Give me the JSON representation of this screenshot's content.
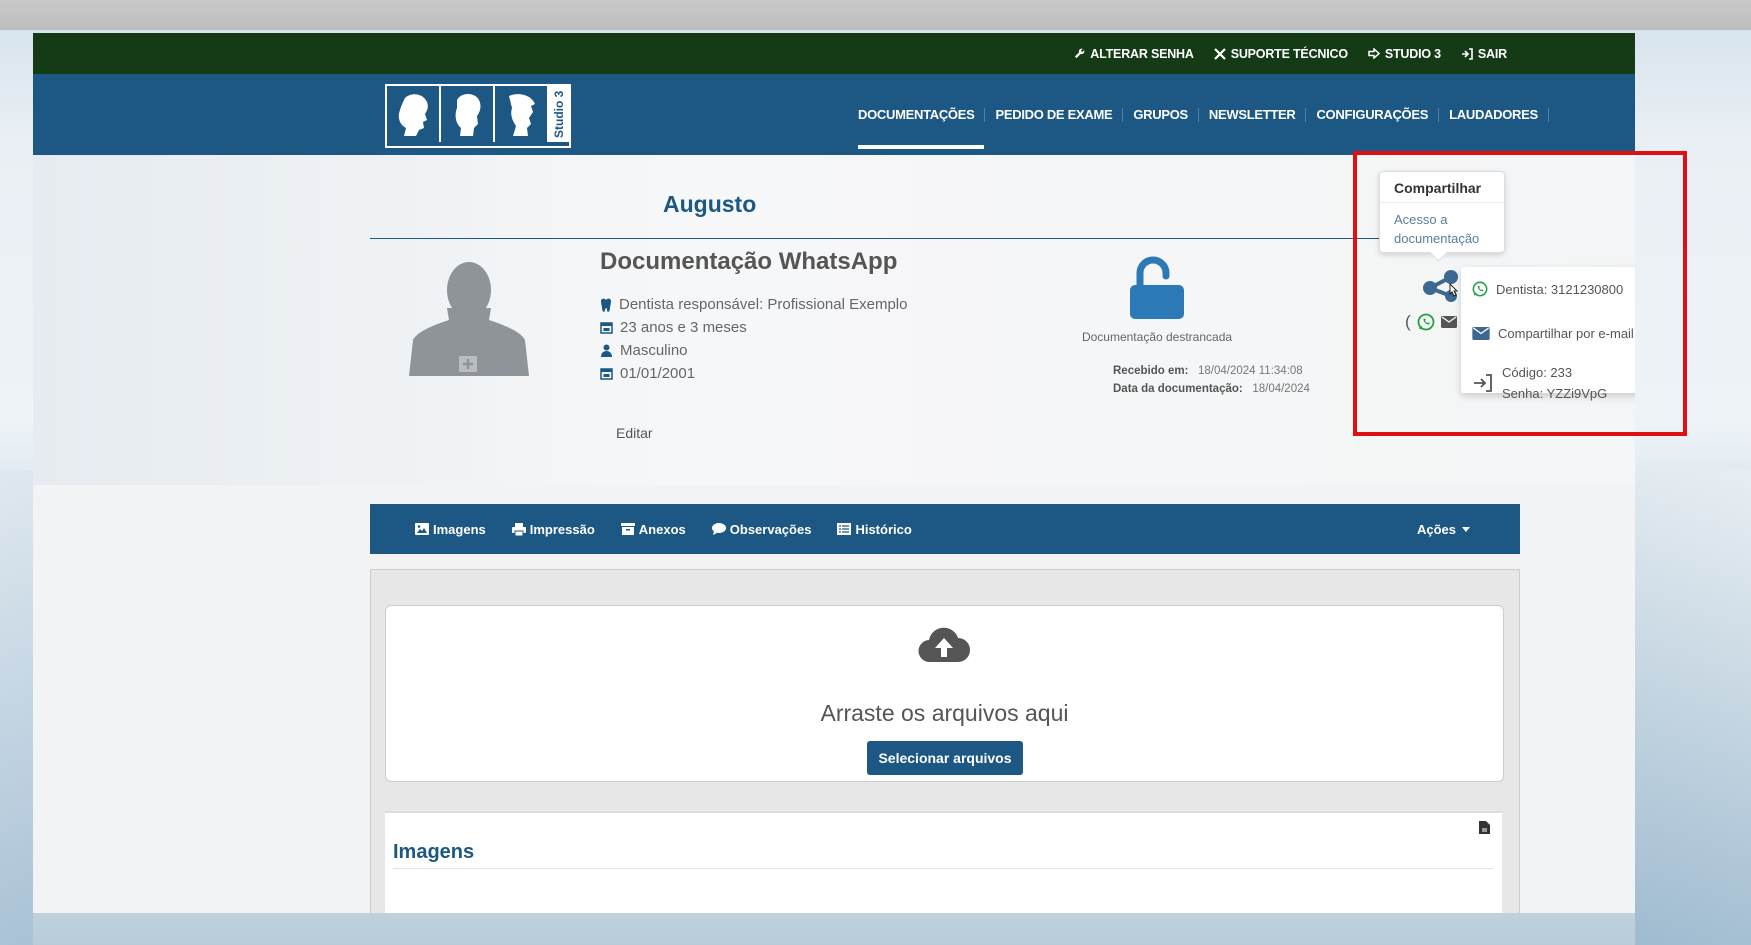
{
  "topbar": {
    "links": [
      {
        "label": "ALTERAR SENHA",
        "icon": "wrench-icon"
      },
      {
        "label": "SUPORTE TÉCNICO",
        "icon": "tools-icon"
      },
      {
        "label": "STUDIO 3",
        "icon": "arrow-right-icon"
      },
      {
        "label": "SAIR",
        "icon": "sign-out-icon"
      }
    ]
  },
  "logo": {
    "text": "Studio 3"
  },
  "nav": {
    "items": [
      "DOCUMENTAÇÕES",
      "PEDIDO DE EXAME",
      "GRUPOS",
      "NEWSLETTER",
      "CONFIGURAÇÕES",
      "LAUDADORES"
    ],
    "active": "DOCUMENTAÇÕES"
  },
  "patient": {
    "name": "Augusto",
    "doc_title": "Documentação WhatsApp",
    "dentist": "Dentista responsável: Profissional Exemplo",
    "age": "23 anos e 3 meses",
    "gender": "Masculino",
    "birthdate": "01/01/2001",
    "edit_label": "Editar"
  },
  "lock": {
    "label": "Documentação destrancada"
  },
  "meta": {
    "received_label": "Recebido em:",
    "received_value": "18/04/2024 11:34:08",
    "doc_date_label": "Data da documentação:",
    "doc_date_value": "18/04/2024"
  },
  "tooltip": {
    "title": "Compartilhar",
    "body": "Acesso a documentação"
  },
  "share_menu": {
    "whatsapp": "Dentista: 3121230800",
    "email": "Compartilhar por e-mail",
    "code": "Código: 233",
    "password": "Senha: YZZi9VpG"
  },
  "mini_paren": "(",
  "tabs": [
    {
      "label": "Imagens",
      "icon": "image-icon"
    },
    {
      "label": "Impressão",
      "icon": "printer-icon"
    },
    {
      "label": "Anexos",
      "icon": "archive-icon"
    },
    {
      "label": "Observações",
      "icon": "comment-icon"
    },
    {
      "label": "Histórico",
      "icon": "list-icon"
    }
  ],
  "actions_label": "Ações",
  "dropzone": {
    "text": "Arraste os arquivos aqui",
    "button": "Selecionar arquivos"
  },
  "images_section": {
    "title": "Imagens"
  },
  "colors": {
    "nav_blue": "#1d5784",
    "top_green": "#143b15",
    "highlight_red": "#dd1111",
    "whatsapp_green": "#25a244"
  }
}
